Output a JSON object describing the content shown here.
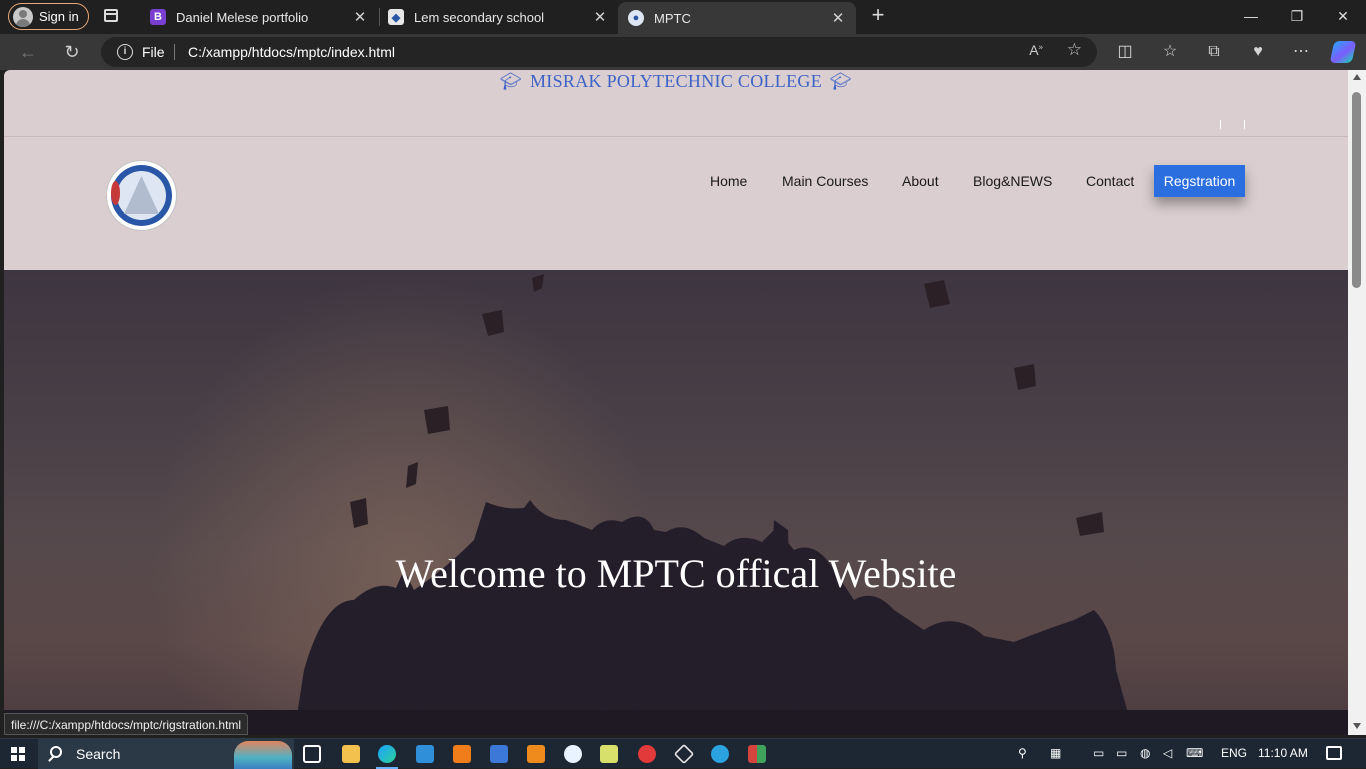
{
  "browser": {
    "signin_label": "Sign in",
    "tabs": [
      {
        "title": "Daniel Melese portfolio",
        "favicon": "bootstrap-icon",
        "favicon_color": "#7a3fd1"
      },
      {
        "title": "Lem secondary school",
        "favicon": "school-logo-icon",
        "favicon_color": "#e7e7e7"
      },
      {
        "title": "MPTC",
        "favicon": "mptc-logo-icon",
        "favicon_color": "#dfe6f3"
      }
    ],
    "address": {
      "scheme_label": "File",
      "url": "C:/xampp/htdocs/mptc/index.html"
    },
    "status_url": "file:///C:/xampp/htdocs/mptc/rigstration.html"
  },
  "site": {
    "college_name": "MISRAK POLYTECHNIC COLLEGE",
    "nav": {
      "items": [
        "Home",
        "Main Courses",
        "About",
        "Blog&NEWS",
        "Contact"
      ],
      "cta": "Regstration"
    },
    "hero": {
      "headline": "Welcome to MPTC offical Website"
    },
    "colors": {
      "page_bg": "#dbced0",
      "title_blue": "#3e63c7",
      "cta_blue": "#2b6ee0"
    }
  },
  "taskbar": {
    "search_label": "Search",
    "language": "ENG",
    "time": "11:10 AM"
  }
}
